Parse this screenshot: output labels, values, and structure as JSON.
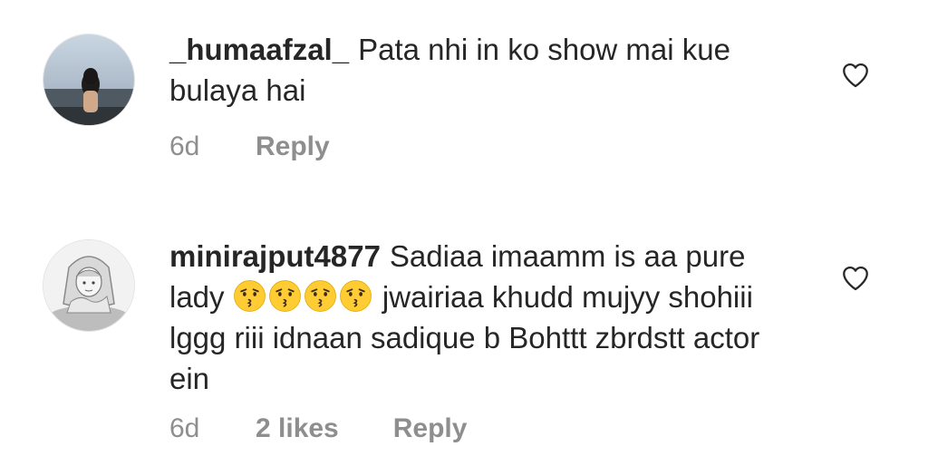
{
  "comments": [
    {
      "username": "_humaafzal_",
      "text": "Pata nhi in ko show mai kue bulaya hai",
      "time": "6d",
      "reply_label": "Reply",
      "avatar_icon": "avatar-photo-woman-sea"
    },
    {
      "username": "minirajput4877",
      "text_before_emoji": "Sadiaa  imaamm is aa pure lady",
      "emojis": [
        "kissing-face",
        "kissing-face",
        "kissing-face",
        "kissing-face"
      ],
      "text_after_emoji": "jwairiaa khudd mujyy shohiii lggg riii idnaan sadique b Bohttt zbrdstt actor ein",
      "time": "6d",
      "likes": "2 likes",
      "reply_label": "Reply",
      "avatar_icon": "avatar-cartoon-girl"
    }
  ],
  "colors": {
    "text": "#262626",
    "meta": "#8e8e8e",
    "emoji_yellow": "#ffcc33"
  }
}
